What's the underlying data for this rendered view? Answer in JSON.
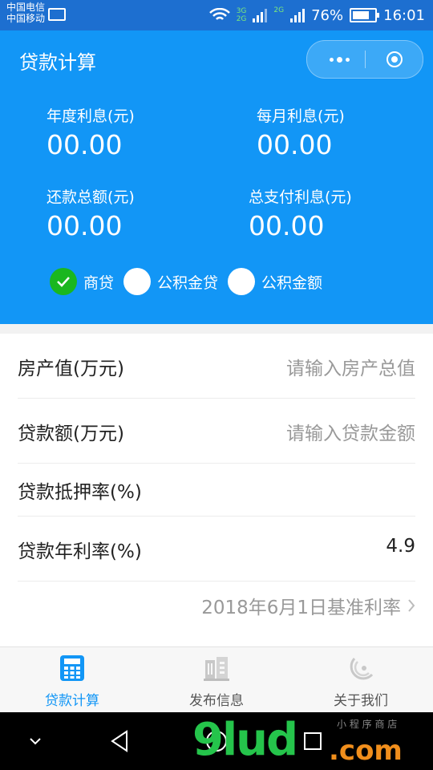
{
  "status_bar": {
    "carrier1": "中国电信",
    "carrier2": "中国移动",
    "net1_top": "3G",
    "net1_bottom": "2G",
    "net2": "2G",
    "battery": "76%",
    "battery_level": 0.76,
    "time": "16:01"
  },
  "header": {
    "title": "贷款计算",
    "bg_color": "#1296f6",
    "metrics": [
      {
        "label": "年度利息(元)",
        "value": "00.00"
      },
      {
        "label": "每月利息(元)",
        "value": "00.00"
      },
      {
        "label": "还款总额(元)",
        "value": "00.00"
      },
      {
        "label": "总支付利息(元)",
        "value": "00.00"
      }
    ],
    "loan_types": [
      {
        "label": "商贷",
        "selected": true
      },
      {
        "label": "公积金贷",
        "selected": false
      },
      {
        "label": "公积金额",
        "selected": false
      }
    ],
    "check_color": "#1ab71f"
  },
  "form": {
    "rows": [
      {
        "label": "房产值(万元)",
        "placeholder": "请输入房产总值",
        "value": ""
      },
      {
        "label": "贷款额(万元)",
        "placeholder": "请输入贷款金额",
        "value": ""
      },
      {
        "label": "贷款抵押率(%)",
        "placeholder": "",
        "value": ""
      },
      {
        "label": "贷款年利率(%)",
        "placeholder": "",
        "value": "4.9"
      }
    ],
    "rate_note": "2018年6月1日基准利率"
  },
  "tabbar": {
    "active_color": "#1296f6",
    "inactive_color": "#555555",
    "tabs": [
      {
        "label": "贷款计算",
        "icon": "calculator-icon",
        "active": true
      },
      {
        "label": "发布信息",
        "icon": "building-icon",
        "active": false
      },
      {
        "label": "关于我们",
        "icon": "logo-icon",
        "active": false
      }
    ]
  },
  "watermark": {
    "main": "9lud",
    "domain": ".com",
    "small": "小 程 序 商 店"
  }
}
